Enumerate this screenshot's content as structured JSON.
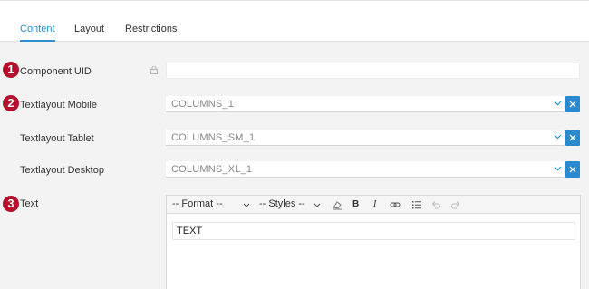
{
  "tabs": [
    {
      "label": "Content",
      "active": true
    },
    {
      "label": "Layout",
      "active": false
    },
    {
      "label": "Restrictions",
      "active": false
    }
  ],
  "markers": [
    "1",
    "2",
    "3"
  ],
  "fields": {
    "component_uid": {
      "label": "Component UID",
      "value": ""
    },
    "textlayout_mobile": {
      "label": "Textlayout Mobile",
      "value": "COLUMNS_1"
    },
    "textlayout_tablet": {
      "label": "Textlayout Tablet",
      "value": "COLUMNS_SM_1"
    },
    "textlayout_desktop": {
      "label": "Textlayout Desktop",
      "value": "COLUMNS_XL_1"
    },
    "text": {
      "label": "Text",
      "content": "TEXT"
    }
  },
  "editor_toolbar": {
    "format_label": "-- Format --",
    "styles_label": "-- Styles --",
    "buttons": [
      "eraser-icon",
      "bold-icon",
      "italic-icon",
      "link-icon",
      "list-icon",
      "undo-icon",
      "redo-icon"
    ],
    "bold_glyph": "B",
    "italic_glyph": "I"
  },
  "colors": {
    "accent": "#2b8fd0",
    "marker": "#b3112d",
    "clear_button": "#2a8ad0"
  }
}
